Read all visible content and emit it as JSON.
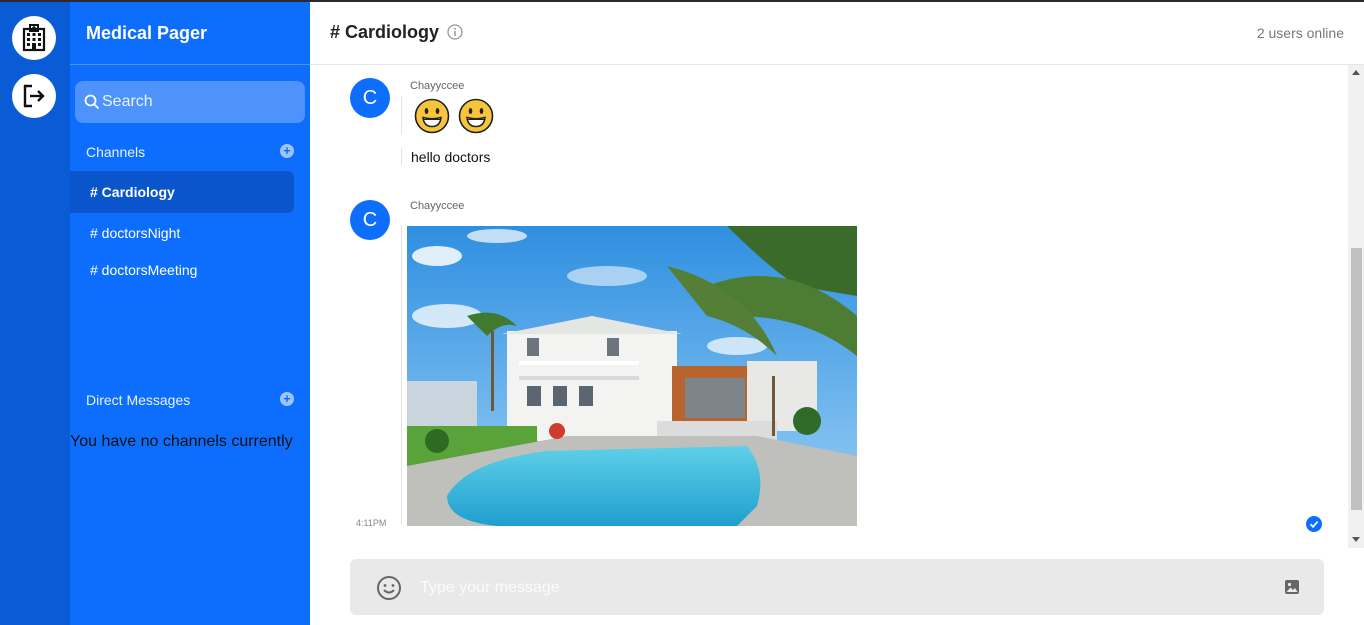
{
  "app": {
    "name": "Medical Pager"
  },
  "rail": {
    "icons": [
      "hospital-icon",
      "logout-icon"
    ]
  },
  "sidebar": {
    "search_placeholder": "Search",
    "channels_title": "Channels",
    "channels": [
      {
        "label": "# Cardiology",
        "active": true
      },
      {
        "label": "# doctorsNight",
        "active": false
      },
      {
        "label": "# doctorsMeeting",
        "active": false
      }
    ],
    "dm_title": "Direct Messages",
    "dm_empty_text": "You have no channels currently"
  },
  "header": {
    "channel_title": "# Cardiology",
    "users_online": "2 users online"
  },
  "messages": [
    {
      "avatar_initial": "C",
      "author": "Chayyccee",
      "emojis": [
        "grinning-face",
        "grinning-face"
      ],
      "text": "hello doctors"
    },
    {
      "avatar_initial": "C",
      "author": "Chayyccee",
      "attachment": "image",
      "time": "4:11PM",
      "status": "read"
    }
  ],
  "composer": {
    "placeholder": "Type your message"
  },
  "colors": {
    "rail": "#0a5bd6",
    "sidebar": "#0d6efd",
    "active_channel": "#0b55cc",
    "accent": "#0d6efd"
  }
}
